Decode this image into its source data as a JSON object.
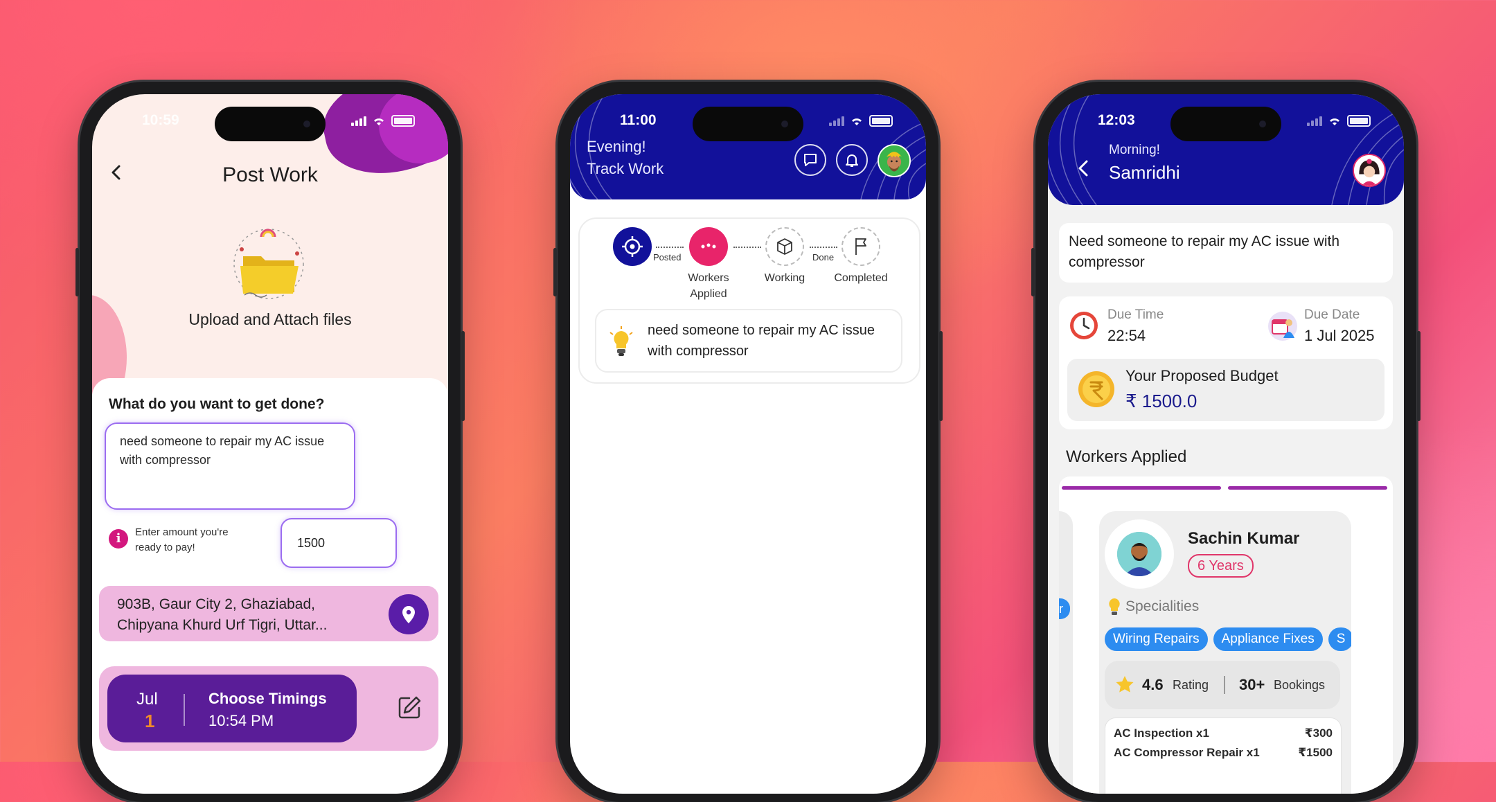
{
  "phone1": {
    "status_time": "10:59",
    "title": "Post Work",
    "upload_label": "Upload and Attach files",
    "question": "What do you want to get done?",
    "task_value": "need someone to repair my AC issue with compressor",
    "amount_hint": "Enter amount you're ready to pay!",
    "amount_value": "1500",
    "address": "903B, Gaur City 2, Ghaziabad, Chipyana Khurd Urf Tigri, Uttar...",
    "date_month": "Jul",
    "date_day": "1",
    "timing_label": "Choose Timings",
    "timing_value": "10:54 PM",
    "info_glyph": "i"
  },
  "phone2": {
    "status_time": "11:00",
    "greeting": "Evening!",
    "subtitle": "Track Work",
    "steps": [
      "Workers Applied",
      "Working",
      "Completed"
    ],
    "connectors": [
      "Posted",
      "Done"
    ],
    "task_text": "need someone to repair my AC issue with compressor"
  },
  "phone3": {
    "status_time": "12:03",
    "greeting": "Morning!",
    "user_name": "Samridhi",
    "task_text": "Need someone to repair my AC issue with compressor",
    "due_time_label": "Due Time",
    "due_time_value": "22:54",
    "due_date_label": "Due Date",
    "due_date_value": "1 Jul 2025",
    "budget_label": "Your Proposed Budget",
    "budget_value": "₹ 1500.0",
    "workers_title": "Workers Applied",
    "worker": {
      "name": "Sachin Kumar",
      "experience": "6 Years",
      "specialities_label": "Specialities",
      "specialities": [
        "Wiring Repairs",
        "Appliance Fixes",
        "S"
      ],
      "rating": "4.6",
      "rating_label": "Rating",
      "bookings": "30+",
      "bookings_label": "Bookings",
      "services": [
        {
          "name": "AC Inspection x1",
          "price": "₹300"
        },
        {
          "name": "AC Compressor Repair x1",
          "price": "₹1500"
        }
      ]
    },
    "ghost_chip_text": "r"
  },
  "colors": {
    "header_blue": "#12119a",
    "purple": "#5a1d98",
    "pink": "#e0366a",
    "chip_blue": "#2d8cf0"
  }
}
